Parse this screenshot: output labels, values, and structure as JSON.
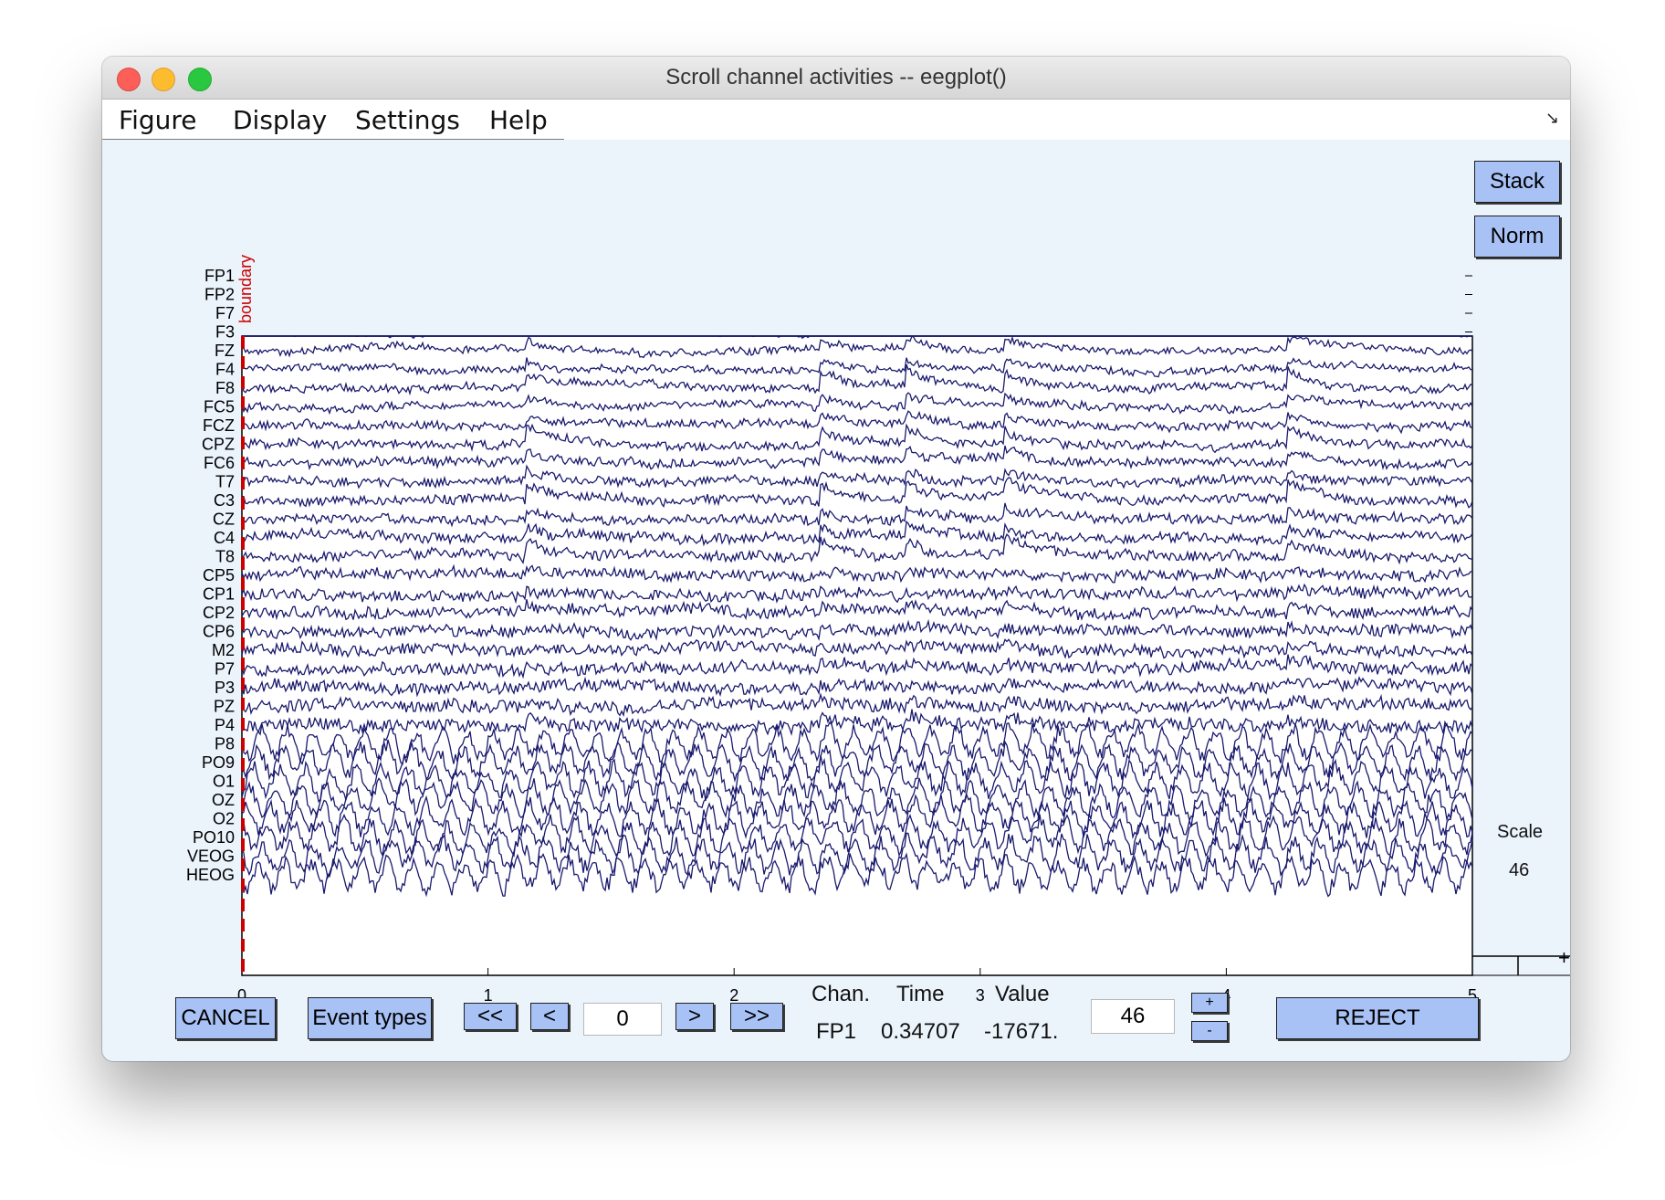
{
  "window": {
    "title": "Scroll channel activities -- eegplot()"
  },
  "menu": [
    "Figure",
    "Display",
    "Settings",
    "Help"
  ],
  "side_buttons": {
    "stack": "Stack",
    "norm": "Norm"
  },
  "event": {
    "label": "boundary",
    "color": "#cc0000"
  },
  "plot": {
    "channels": [
      "FP1",
      "FP2",
      "F7",
      "F3",
      "FZ",
      "F4",
      "F8",
      "FC5",
      "FCZ",
      "CPZ",
      "FC6",
      "T7",
      "C3",
      "CZ",
      "C4",
      "T8",
      "CP5",
      "CP1",
      "CP2",
      "CP6",
      "M2",
      "P7",
      "P3",
      "PZ",
      "P4",
      "P8",
      "PO9",
      "O1",
      "OZ",
      "O2",
      "PO10",
      "VEOG",
      "HEOG"
    ],
    "x_ticks": [
      "0",
      "1",
      "2",
      "3",
      "4",
      "5"
    ],
    "x_range": [
      0,
      5
    ],
    "trace_color": "#1a1a6e"
  },
  "scale": {
    "label": "Scale",
    "value": "46"
  },
  "controls": {
    "cancel": "CANCEL",
    "event_types": "Event types",
    "first": "<<",
    "prev": "<",
    "position": "0",
    "next": ">",
    "last": ">>",
    "scale_value": "46",
    "plus": "+",
    "minus": "-",
    "reject": "REJECT"
  },
  "readout": {
    "chan_label": "Chan.",
    "time_label": "Time",
    "value_label": "Value",
    "chan": "FP1",
    "time": "0.34707",
    "value": "-17671."
  }
}
